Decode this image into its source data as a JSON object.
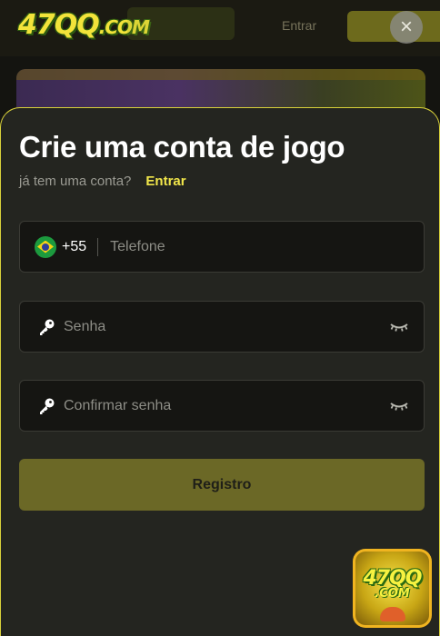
{
  "header": {
    "logo_text": "47QQ",
    "logo_suffix": ".COM",
    "login_label": "Entrar",
    "close_symbol": "×"
  },
  "form": {
    "title": "Crie uma conta de jogo",
    "subtitle": "já tem uma conta?",
    "login_link": "Entrar",
    "phone": {
      "country_code": "+55",
      "flag": "brazil-flag-icon",
      "placeholder": "Telefone"
    },
    "password": {
      "placeholder": "Senha",
      "icon": "key-icon",
      "toggle_icon": "eye-closed-icon"
    },
    "confirm_password": {
      "placeholder": "Confirmar senha",
      "icon": "key-icon",
      "toggle_icon": "eye-closed-icon"
    },
    "submit_label": "Registro"
  },
  "app_badge": {
    "logo_text": "47QQ",
    "logo_suffix": ".COM"
  },
  "colors": {
    "accent": "#f1e64a",
    "sheet_background": "#242520",
    "field_background": "#151512",
    "submit_background": "#6b6826"
  }
}
